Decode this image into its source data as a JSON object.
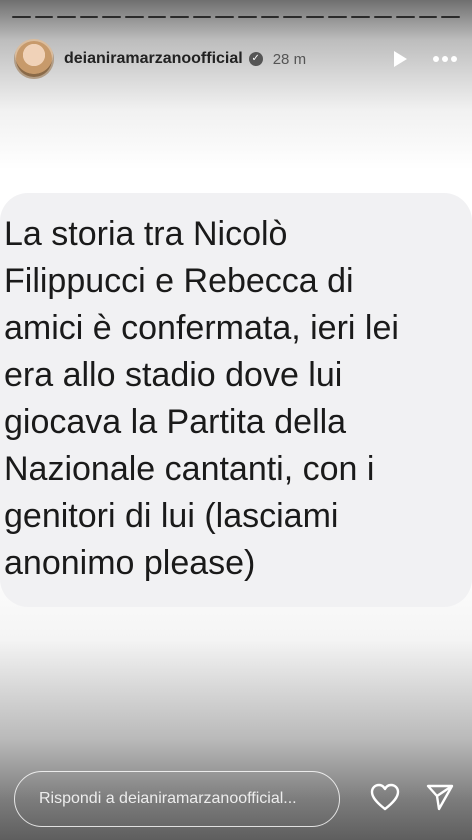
{
  "story": {
    "username": "deianiramarzanoofficial",
    "time": "28 m",
    "segments": 20,
    "message": "La storia tra Nicolò Filippucci e Rebecca di amici è confermata, ieri lei era allo stadio dove lui giocava la Partita della Nazionale cantanti, con i genitori di lui (lasciami anonimo please)"
  },
  "icons": {
    "play": "play-icon",
    "more": "more-icon",
    "verified": "verified-badge-icon",
    "like": "heart-icon",
    "share": "send-icon"
  },
  "reply": {
    "placeholder": "Rispondi a deianiramarzanoofficial..."
  }
}
